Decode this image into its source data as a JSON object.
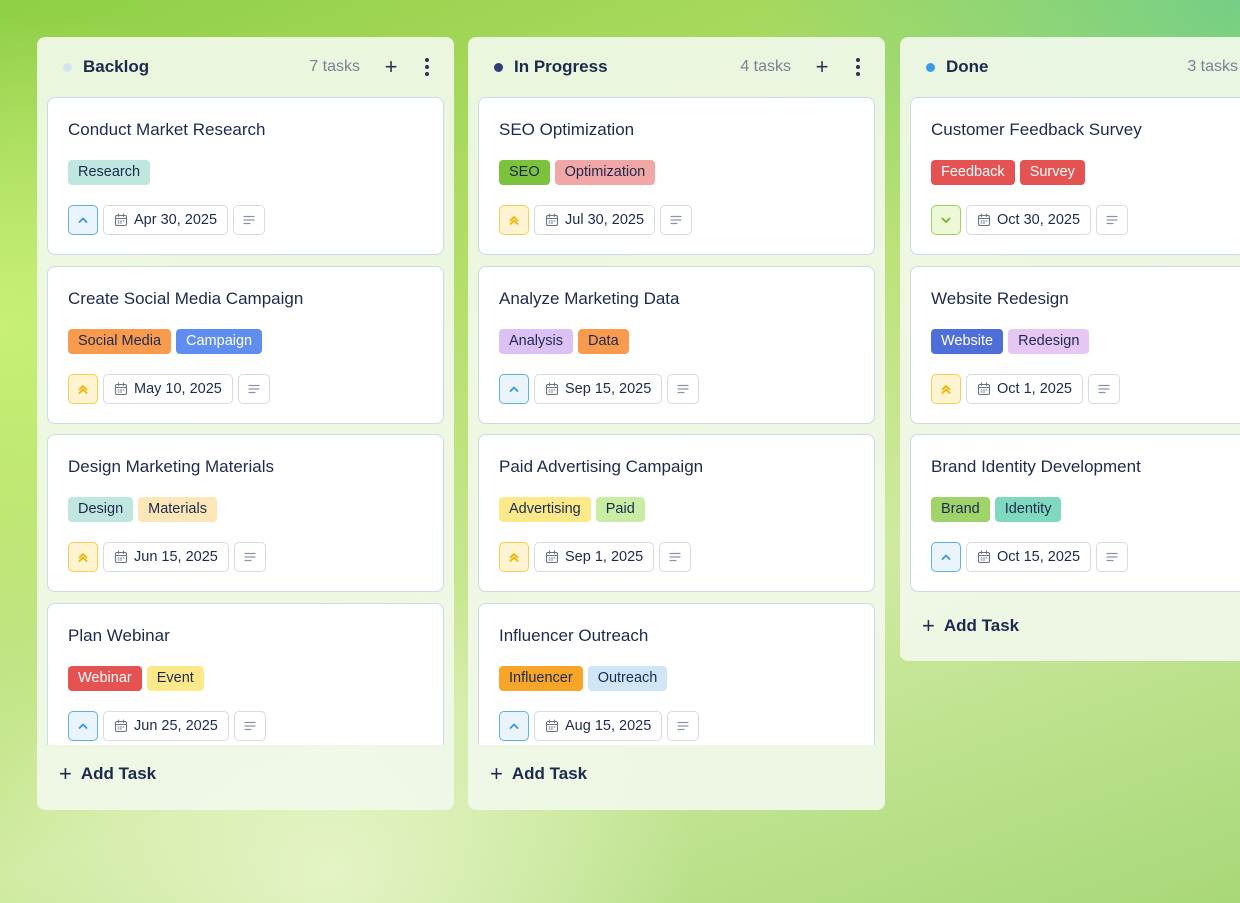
{
  "columns": [
    {
      "id": "backlog",
      "title": "Backlog",
      "count": "7 tasks",
      "dot_color": "#d5e3f3",
      "add_label": "Add Task",
      "cards": [
        {
          "title": "Conduct Market Research",
          "tags": [
            {
              "label": "Research",
              "color": "#bfe7df"
            }
          ],
          "priority": "medium",
          "date": "Apr 30, 2025"
        },
        {
          "title": "Create Social Media Campaign",
          "tags": [
            {
              "label": "Social Media",
              "color": "#f99b4f"
            },
            {
              "label": "Campaign",
              "color": "#5f8ef0",
              "text_color": "#ffffff"
            }
          ],
          "priority": "high",
          "date": "May 10, 2025"
        },
        {
          "title": "Design Marketing Materials",
          "tags": [
            {
              "label": "Design",
              "color": "#bfe7df"
            },
            {
              "label": "Materials",
              "color": "#fde7b8"
            }
          ],
          "priority": "high",
          "date": "Jun 15, 2025"
        },
        {
          "title": "Plan Webinar",
          "tags": [
            {
              "label": "Webinar",
              "color": "#e45252",
              "text_color": "#ffffff"
            },
            {
              "label": "Event",
              "color": "#fde98a"
            }
          ],
          "priority": "medium",
          "date": "Jun 25, 2025"
        }
      ]
    },
    {
      "id": "in-progress",
      "title": "In Progress",
      "count": "4 tasks",
      "dot_color": "#2c3f78",
      "add_label": "Add Task",
      "cards": [
        {
          "title": "SEO Optimization",
          "tags": [
            {
              "label": "SEO",
              "color": "#7dc23c"
            },
            {
              "label": "Optimization",
              "color": "#f2a7a7"
            }
          ],
          "priority": "high",
          "date": "Jul 30, 2025"
        },
        {
          "title": "Analyze Marketing Data",
          "tags": [
            {
              "label": "Analysis",
              "color": "#dcc1f4"
            },
            {
              "label": "Data",
              "color": "#f99b4f"
            }
          ],
          "priority": "medium",
          "date": "Sep 15, 2025"
        },
        {
          "title": "Paid Advertising Campaign",
          "tags": [
            {
              "label": "Advertising",
              "color": "#fde98a"
            },
            {
              "label": "Paid",
              "color": "#c9eda5"
            }
          ],
          "priority": "high",
          "date": "Sep 1, 2025"
        },
        {
          "title": "Influencer Outreach",
          "tags": [
            {
              "label": "Influencer",
              "color": "#f7a62a"
            },
            {
              "label": "Outreach",
              "color": "#cfe6f6"
            }
          ],
          "priority": "medium",
          "date": "Aug 15, 2025"
        }
      ]
    },
    {
      "id": "done",
      "title": "Done",
      "count": "3 tasks",
      "dot_color": "#3d9be6",
      "add_label": "Add Task",
      "cards": [
        {
          "title": "Customer Feedback Survey",
          "tags": [
            {
              "label": "Feedback",
              "color": "#e45252",
              "text_color": "#ffffff"
            },
            {
              "label": "Survey",
              "color": "#e45252",
              "text_color": "#ffffff"
            }
          ],
          "priority": "low",
          "date": "Oct 30, 2025"
        },
        {
          "title": "Website Redesign",
          "tags": [
            {
              "label": "Website",
              "color": "#4f6fd8",
              "text_color": "#ffffff"
            },
            {
              "label": "Redesign",
              "color": "#e6c7f4"
            }
          ],
          "priority": "high",
          "date": "Oct 1, 2025"
        },
        {
          "title": "Brand Identity Development",
          "tags": [
            {
              "label": "Brand",
              "color": "#9fd46a"
            },
            {
              "label": "Identity",
              "color": "#7fd9bf"
            }
          ],
          "priority": "medium",
          "date": "Oct 15, 2025"
        }
      ]
    }
  ],
  "icons": {
    "priority_medium": "chevron-up-icon",
    "priority_high": "double-chevron-up-icon",
    "priority_low": "chevron-down-icon",
    "date": "calendar-icon",
    "notes": "notes-icon",
    "add": "plus-icon",
    "more": "more-vertical-icon"
  },
  "colors": {
    "priority_medium": "#3a95d9",
    "priority_high": "#f1b300",
    "priority_low": "#6fb82c"
  }
}
